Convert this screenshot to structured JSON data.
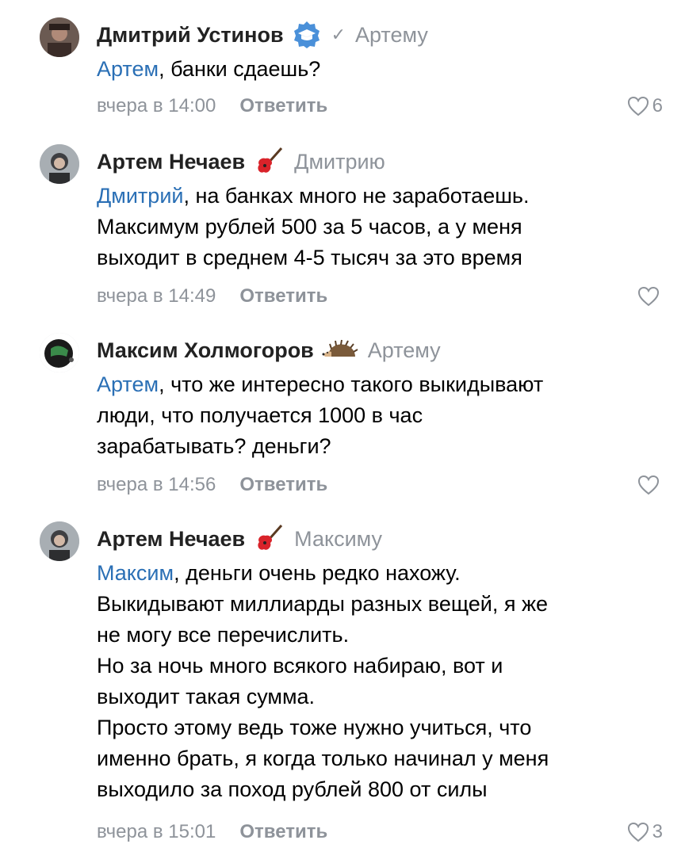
{
  "comments": [
    {
      "author": "Дмитрий Устинов",
      "badge": "verified-education-icon",
      "reply_to": "Артему",
      "mention": "Артем",
      "lines": [
        ", банки сдаешь?"
      ],
      "time": "вчера в 14:00",
      "reply_label": "Ответить",
      "likes": "6"
    },
    {
      "author": "Артем Нечаев",
      "badge": "guitar-icon",
      "reply_to": "Дмитрию",
      "mention": "Дмитрий",
      "lines": [
        ", на банках много не заработаешь.",
        "Максимум рублей 500 за 5 часов, а у меня",
        "выходит в среднем 4-5 тысяч за это время"
      ],
      "time": "вчера в 14:49",
      "reply_label": "Ответить",
      "likes": ""
    },
    {
      "author": "Максим Холмогоров",
      "badge": "hedgehog-icon",
      "reply_to": "Артему",
      "mention": "Артем",
      "lines": [
        ", что же интересно такого выкидывают",
        "люди, что получается 1000 в час",
        "зарабатывать? деньги?"
      ],
      "time": "вчера в 14:56",
      "reply_label": "Ответить",
      "likes": ""
    },
    {
      "author": "Артем Нечаев",
      "badge": "guitar-icon",
      "reply_to": "Максиму",
      "mention": "Максим",
      "lines": [
        ", деньги очень редко нахожу.",
        "Выкидывают миллиарды разных вещей, я же",
        "не могу все перечислить.",
        "Но за ночь много всякого набираю, вот и",
        "выходит такая сумма.",
        "Просто этому ведь тоже нужно учиться, что",
        "именно брать, я когда только начинал у меня",
        "выходило за поход рублей 800 от силы"
      ],
      "time": "вчера в 15:01",
      "reply_label": "Ответить",
      "likes": "3"
    }
  ],
  "colors": {
    "mention": "#2a6fb5",
    "muted": "#8e939a",
    "badge_blue": "#4a90d9"
  }
}
